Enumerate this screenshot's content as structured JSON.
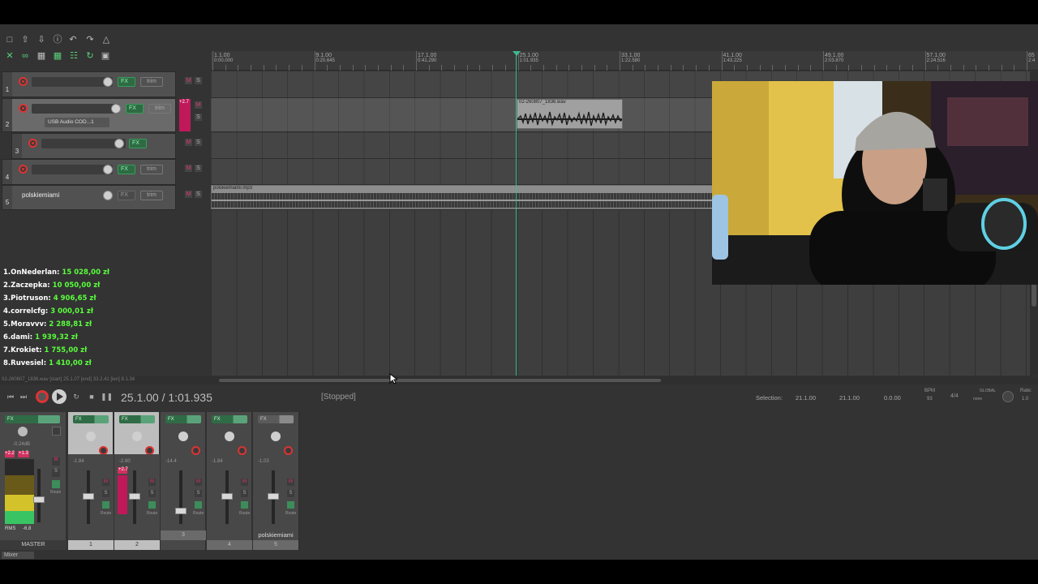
{
  "toolbar": {
    "row1": [
      "new-project",
      "open-project",
      "save-project",
      "project-settings",
      "undo",
      "redo",
      "metronome"
    ],
    "row2": [
      "ripple-edit",
      "snap",
      "grid",
      "envelope-lock",
      "grid-lines",
      "loop",
      "lock"
    ]
  },
  "tracks": [
    {
      "number": "1",
      "name": "",
      "fx": "FX",
      "trim": "trim",
      "mute": "M",
      "solo": "S",
      "selected": false
    },
    {
      "number": "2",
      "name": "",
      "fx": "FX",
      "trim": "trim",
      "mute": "M",
      "solo": "S",
      "selected": true,
      "input": "USB Audio COD...1",
      "meter_peak": "+2.7"
    },
    {
      "number": "3",
      "name": "",
      "fx": "FX",
      "trim": "",
      "mute": "M",
      "solo": "S",
      "selected": false
    },
    {
      "number": "4",
      "name": "",
      "fx": "FX",
      "trim": "trim",
      "mute": "M",
      "solo": "S",
      "selected": false
    },
    {
      "number": "5",
      "name": "polskiemiami",
      "fx": "FX",
      "trim": "trim",
      "mute": "M",
      "solo": "S",
      "selected": false
    }
  ],
  "ruler": [
    {
      "bar": "1.1.00",
      "time": "0:00.000"
    },
    {
      "bar": "9.1.00",
      "time": "0:20.645"
    },
    {
      "bar": "17.1.00",
      "time": "0:41.290"
    },
    {
      "bar": "25.1.00",
      "time": "1:01.935"
    },
    {
      "bar": "33.1.00",
      "time": "1:22.580"
    },
    {
      "bar": "41.1.00",
      "time": "1:43.225"
    },
    {
      "bar": "49.1.00",
      "time": "2:03.870"
    },
    {
      "bar": "57.1.00",
      "time": "2:24.516"
    },
    {
      "bar": "65",
      "time": "2:4"
    }
  ],
  "items": {
    "recorded": "02-260807_1836.wav",
    "backing": "polskiemiami.mp3"
  },
  "status_line": "02-260807_1836.wav [start] 25.1.07 [end] 33.2.41 [len] 8.1.34",
  "leaderboard": [
    {
      "rank": "1.",
      "name": "OnNederlan:",
      "amount": "15 028,00 zł"
    },
    {
      "rank": "2.",
      "name": "Zaczepka:",
      "amount": "10 050,00 zł"
    },
    {
      "rank": "3.",
      "name": "Piotruson:",
      "amount": "4 906,65 zł"
    },
    {
      "rank": "4.",
      "name": "correlcfg:",
      "amount": "3 000,01 zł"
    },
    {
      "rank": "5.",
      "name": "Moravvv:",
      "amount": "2 288,81 zł"
    },
    {
      "rank": "6.",
      "name": "dami:",
      "amount": "1 939,32 zł"
    },
    {
      "rank": "7.",
      "name": "Krokiet:",
      "amount": "1 755,00 zł"
    },
    {
      "rank": "8.",
      "name": "Ruvesiel:",
      "amount": "1 410,00 zł"
    }
  ],
  "transport": {
    "position": "25.1.00 / 1:01.935",
    "state": "[Stopped]",
    "selection_label": "Selection:",
    "selection_start": "21.1.00",
    "selection_end": "21.1.00",
    "selection_length": "0.0.00",
    "bpm_label": "BPM",
    "bpm": "93",
    "time_signature": "4/4",
    "global": "GLOBAL",
    "global_mode": "none",
    "rate_label": "Rate:",
    "rate": "1.0"
  },
  "mixer": {
    "master": {
      "label": "MASTER",
      "db": "-0.24dB",
      "peak_l": "+2.2",
      "peak_r": "+1.3",
      "rms_label": "RMS",
      "rms": "-6.8",
      "fx": "FX",
      "mode": "Route"
    },
    "strips": [
      {
        "number": "1",
        "name": "",
        "db": "-1.84",
        "fx": "FX",
        "mode": "Route"
      },
      {
        "number": "2",
        "name": "",
        "db": "-2.90",
        "fx": "FX",
        "peak": "+2.7",
        "mode": "Route"
      },
      {
        "number": "3",
        "name": "",
        "db": "-14.4",
        "fx": "FX",
        "mode": "Route"
      },
      {
        "number": "4",
        "name": "",
        "db": "-1.84",
        "fx": "FX",
        "mode": "Route"
      },
      {
        "number": "5",
        "name": "polskiemiami",
        "db": "-1.03",
        "fx": "FX",
        "mode": "Route"
      }
    ],
    "tab": "Mixer"
  },
  "colors": {
    "accent_green": "#3fb98e",
    "record_red": "#dd3333",
    "leader_amount": "#59ff3c"
  }
}
